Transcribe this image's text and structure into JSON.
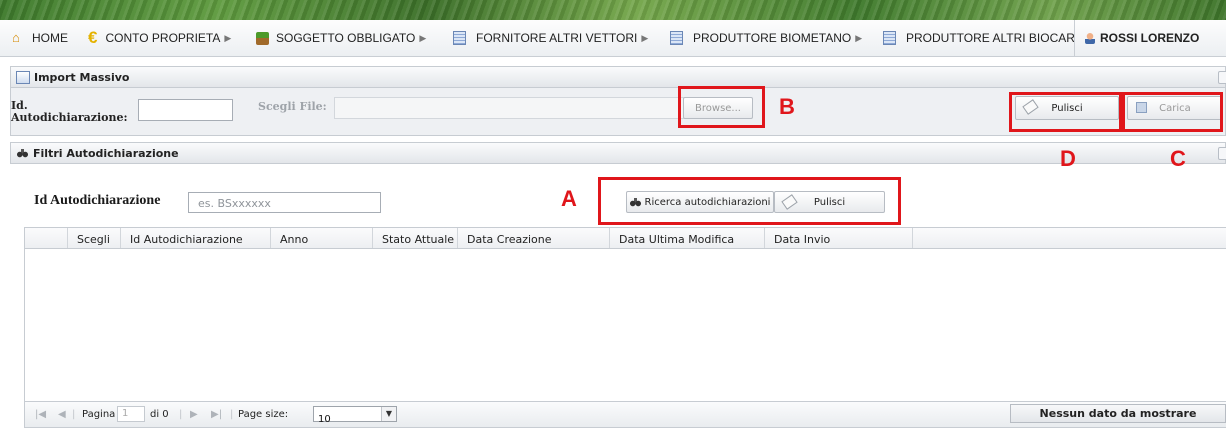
{
  "nav": {
    "home": "HOME",
    "conto": "CONTO PROPRIETA",
    "soggetto": "SOGGETTO OBBLIGATO",
    "fornitore": "FORNITORE ALTRI VETTORI",
    "biometano": "PRODUTTORE BIOMETANO",
    "biocar": "PRODUTTORE ALTRI BIOCAR",
    "user": "ROSSI LORENZO"
  },
  "import_panel": {
    "title": "Import Massivo",
    "id_label_line1": "Id.",
    "id_label_line2": "Autodichiarazione:",
    "file_label": "Scegli File:",
    "browse_label": "Browse...",
    "pulisci_label": "Pulisci",
    "carica_label": "Carica"
  },
  "filter_panel": {
    "title": "Filtri Autodichiarazione",
    "id_label": "Id Autodichiarazione",
    "id_placeholder": "es. BSxxxxxx",
    "search_label": "Ricerca autodichiarazioni",
    "pulisci_label": "Pulisci"
  },
  "grid": {
    "columns": [
      "Scegli",
      "Id Autodichiarazione",
      "Anno",
      "Stato Attuale",
      "Data Creazione",
      "Data Ultima Modifica",
      "Data Invio"
    ],
    "pager": {
      "page_label": "Pagina",
      "page_value": "1",
      "of_label": "di 0",
      "page_size_label": "Page size:",
      "page_size_value": "10",
      "no_data": "Nessun dato da mostrare"
    }
  },
  "annotations": {
    "a": "A",
    "b": "B",
    "c": "C",
    "d": "D"
  },
  "colors": {
    "annotation_red": "#e0161b",
    "banner_green": "#4a8a34"
  }
}
